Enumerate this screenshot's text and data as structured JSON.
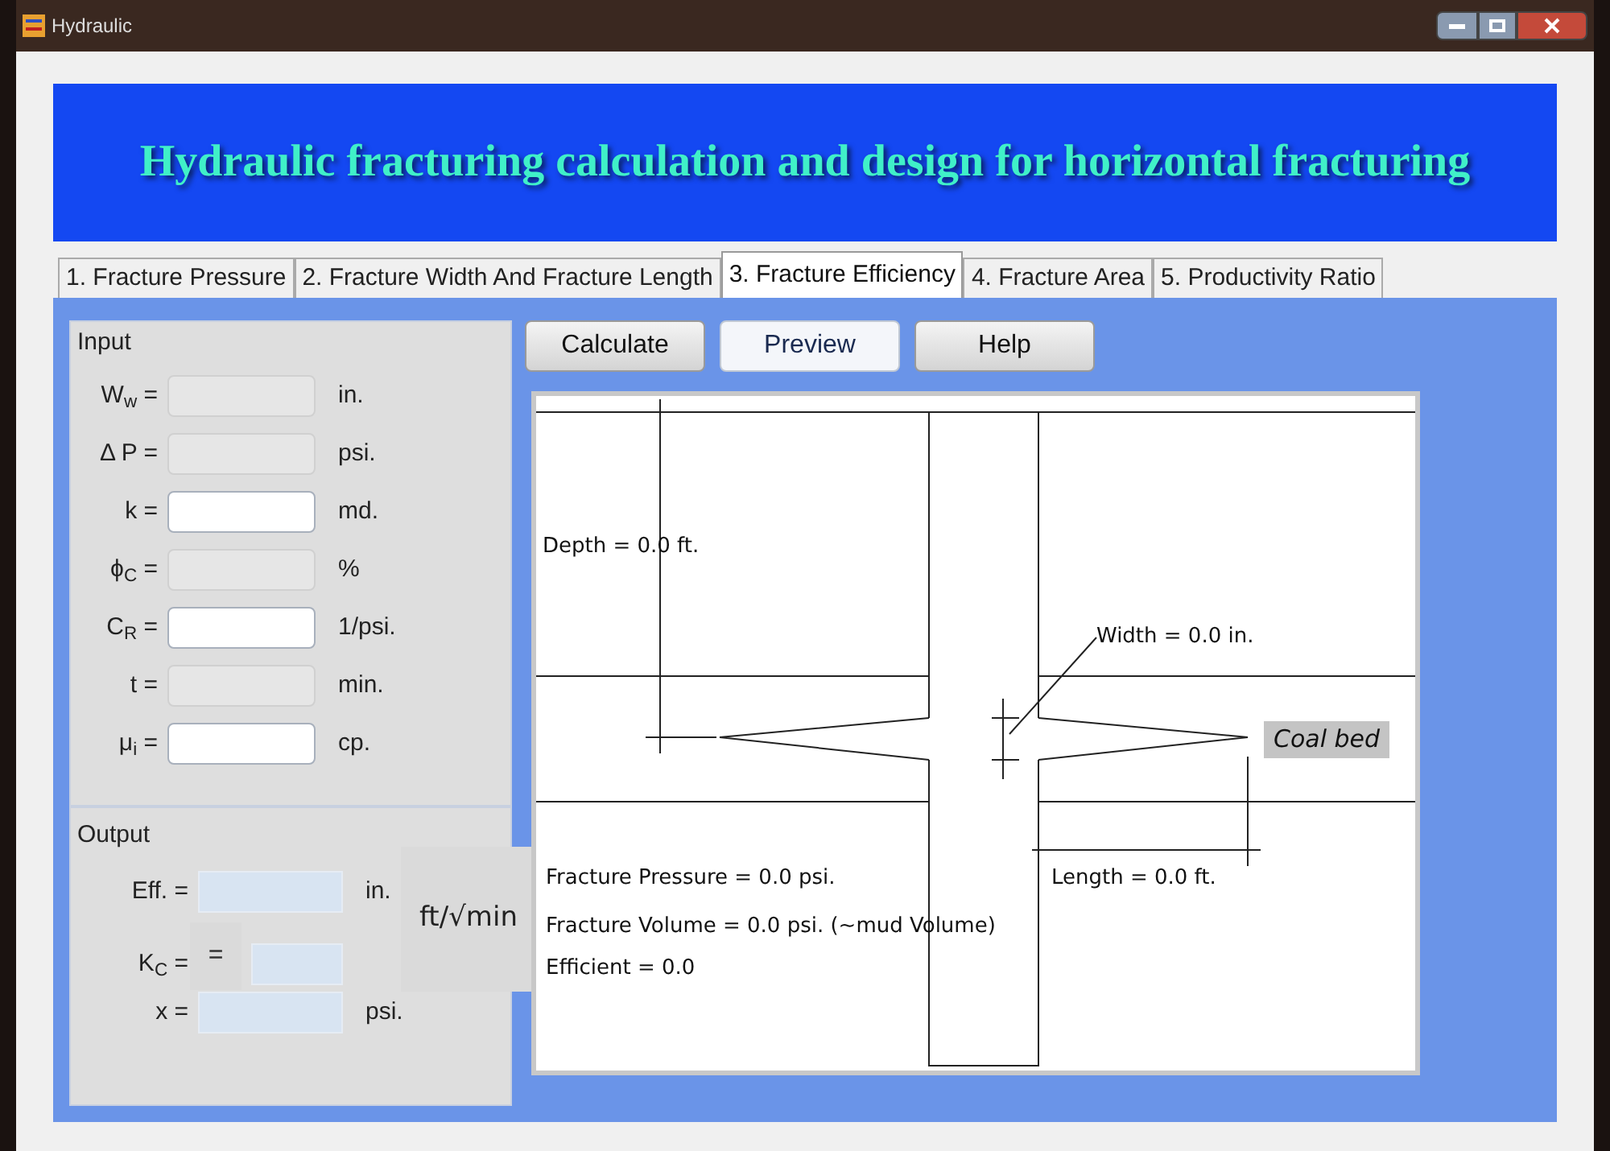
{
  "window": {
    "title": "Hydraulic"
  },
  "banner": {
    "title": "Hydraulic fracturing calculation and design for horizontal fracturing"
  },
  "tabs": [
    {
      "label": "1. Fracture Pressure",
      "selected": false
    },
    {
      "label": "2. Fracture Width And Fracture Length",
      "selected": false
    },
    {
      "label": "3. Fracture Efficiency",
      "selected": true
    },
    {
      "label": "4. Fracture Area",
      "selected": false
    },
    {
      "label": "5. Productivity Ratio",
      "selected": false
    }
  ],
  "input_group": {
    "legend": "Input",
    "rows": [
      {
        "label": "W$_{w}$ =",
        "unit": "in.",
        "disabled": true
      },
      {
        "label": "Δ P  =",
        "unit": "psi.",
        "disabled": true
      },
      {
        "label": "k  =",
        "unit": "md.",
        "disabled": false
      },
      {
        "label": "ϕ$_{C}$ =",
        "unit": "%",
        "disabled": true
      },
      {
        "label": "C$_{R}$ =",
        "unit": "1/psi.",
        "disabled": false
      },
      {
        "label": "t  =",
        "unit": "min.",
        "disabled": true
      },
      {
        "label": "μ$_{i}$ =",
        "unit": "cp.",
        "disabled": false
      }
    ]
  },
  "output_group": {
    "legend": "Output",
    "rows": [
      {
        "label": "Eff. =",
        "unit": "in."
      },
      {
        "label": "K$_{C}$ =",
        "unit": ""
      },
      {
        "label": "x  =",
        "unit": "psi."
      }
    ],
    "overlay_labels": [
      "=",
      "ft/√min"
    ]
  },
  "buttons": [
    {
      "label": "Calculate",
      "focused": false
    },
    {
      "label": "Preview",
      "focused": true
    },
    {
      "label": "Help",
      "focused": false
    }
  ],
  "diagram": {
    "labels": [
      {
        "kind": "depth",
        "text": "Depth = 0.0 ft."
      },
      {
        "kind": "width",
        "text": "Width = 0.0 in."
      },
      {
        "kind": "coal_bed",
        "text": "Coal bed"
      },
      {
        "kind": "pressure",
        "text": "Fracture Pressure  = 0.0 psi."
      },
      {
        "kind": "length",
        "text": "Length = 0.0 ft."
      },
      {
        "kind": "volume",
        "text": "Fracture Volume = 0.0 psi. (~mud Volume)"
      },
      {
        "kind": "efficiency",
        "text": "Efficient = 0.0"
      }
    ]
  }
}
